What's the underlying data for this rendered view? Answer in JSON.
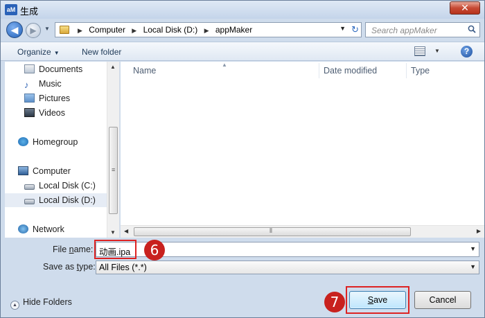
{
  "window": {
    "title": "生成",
    "app_icon_text": "aM",
    "close_label": "✕"
  },
  "address": {
    "crumbs": [
      "Computer",
      "Local Disk (D:)",
      "appMaker"
    ],
    "search_placeholder": "Search appMaker"
  },
  "toolbar": {
    "organize_label": "Organize",
    "new_folder_label": "New folder",
    "help_label": "?"
  },
  "nav": {
    "items": [
      {
        "label": "Documents",
        "icon": "documents-icon"
      },
      {
        "label": "Music",
        "icon": "music-icon"
      },
      {
        "label": "Pictures",
        "icon": "pictures-icon"
      },
      {
        "label": "Videos",
        "icon": "videos-icon"
      },
      {
        "label": "Homegroup",
        "icon": "homegroup-icon"
      },
      {
        "label": "Computer",
        "icon": "computer-icon"
      },
      {
        "label": "Local Disk (C:)",
        "icon": "drive-icon"
      },
      {
        "label": "Local Disk (D:)",
        "icon": "drive-icon",
        "selected": true
      },
      {
        "label": "Network",
        "icon": "network-icon"
      }
    ]
  },
  "columns": {
    "name": "Name",
    "date": "Date modified",
    "type": "Type"
  },
  "form": {
    "file_name_label_pre": "File ",
    "file_name_label_u": "n",
    "file_name_label_post": "ame:",
    "file_name_value": "动画.ipa",
    "save_type_label_pre": "Save as ",
    "save_type_label_u": "t",
    "save_type_label_post": "ype:",
    "save_type_value": "All Files (*.*)"
  },
  "footer": {
    "hide_folders_label": "Hide Folders",
    "save_label_u": "S",
    "save_label_post": "ave",
    "cancel_label": "Cancel"
  },
  "annotations": {
    "step_filename": "6",
    "step_save": "7"
  },
  "colors": {
    "annotation_red": "#c8211e",
    "highlight_red": "#dd2222",
    "accent_blue": "#1f5fb8"
  }
}
